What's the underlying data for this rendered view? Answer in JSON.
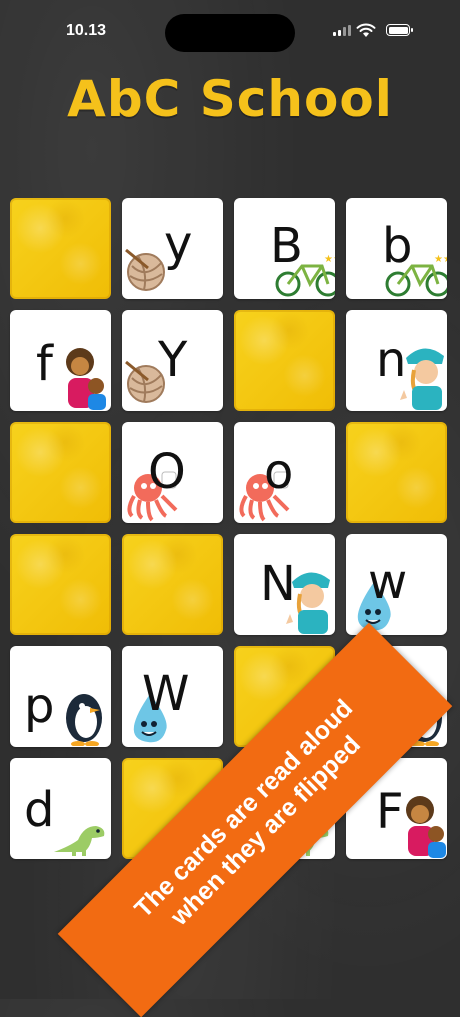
{
  "status_bar": {
    "time": "10.13"
  },
  "app": {
    "title": "AbC School"
  },
  "cards": [
    {
      "state": "hidden"
    },
    {
      "state": "revealed",
      "letter": "y",
      "picture": "yarn-ball-icon"
    },
    {
      "state": "revealed",
      "letter": "B",
      "picture": "bicycle-icon"
    },
    {
      "state": "revealed",
      "letter": "b",
      "picture": "bicycle-icon"
    },
    {
      "state": "revealed",
      "letter": "f",
      "picture": "family-icon"
    },
    {
      "state": "revealed",
      "letter": "Y",
      "picture": "yarn-ball-icon"
    },
    {
      "state": "hidden"
    },
    {
      "state": "revealed",
      "letter": "n",
      "picture": "nurse-icon"
    },
    {
      "state": "hidden"
    },
    {
      "state": "revealed",
      "letter": "O",
      "picture": "octopus-icon"
    },
    {
      "state": "revealed",
      "letter": "o",
      "picture": "octopus-icon"
    },
    {
      "state": "hidden"
    },
    {
      "state": "hidden"
    },
    {
      "state": "hidden"
    },
    {
      "state": "revealed",
      "letter": "N",
      "picture": "nurse-icon"
    },
    {
      "state": "revealed",
      "letter": "w",
      "picture": "water-drop-icon"
    },
    {
      "state": "revealed",
      "letter": "p",
      "picture": "penguin-icon"
    },
    {
      "state": "revealed",
      "letter": "W",
      "picture": "water-drop-icon"
    },
    {
      "state": "hidden"
    },
    {
      "state": "revealed",
      "letter": "P",
      "picture": "penguin-icon"
    },
    {
      "state": "revealed",
      "letter": "d",
      "picture": "dinosaur-icon"
    },
    {
      "state": "hidden"
    },
    {
      "state": "revealed",
      "letter": "D",
      "picture": "dinosaur-icon"
    },
    {
      "state": "revealed",
      "letter": "F",
      "picture": "family-icon"
    }
  ],
  "banner": {
    "line1": "The cards are read aloud",
    "line2": "when they are flipped",
    "color": "#f26b12"
  },
  "colors": {
    "title": "#f5c11b",
    "card_back": "#f5cc12"
  }
}
